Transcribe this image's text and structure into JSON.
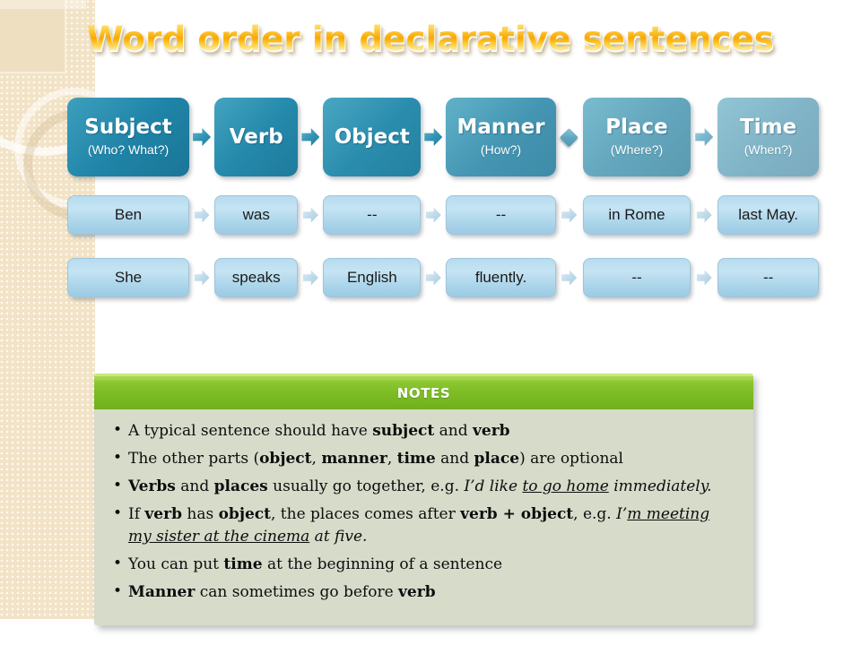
{
  "slide": {
    "title": "Word order in declarative sentences",
    "title_color": "#f9a800",
    "background_color": "#ffffff"
  },
  "decoration": {
    "strip_color": "#f2e3c6",
    "ring_color": "#ffffff"
  },
  "flow": {
    "headers": [
      {
        "title": "Subject",
        "subtitle": "(Who? What?)",
        "color": "#1f84a8"
      },
      {
        "title": "Verb",
        "subtitle": "",
        "color": "#2489ab"
      },
      {
        "title": "Object",
        "subtitle": "",
        "color": "#2b8dae"
      },
      {
        "title": "Manner",
        "subtitle": "(How?)",
        "color": "#4596b3"
      },
      {
        "title": "Place",
        "subtitle": "(Where?)",
        "color": "#63a6bd"
      },
      {
        "title": "Time",
        "subtitle": "(When?)",
        "color": "#81b4c7"
      }
    ],
    "connector_icons": [
      "arrow-right-icon",
      "arrow-right-icon",
      "arrow-right-icon",
      "diamond-icon",
      "arrow-right-icon"
    ],
    "examples": [
      {
        "label": "example-row-ben",
        "cells": [
          "Ben",
          "was",
          "--",
          "--",
          "in Rome",
          "last May."
        ]
      },
      {
        "label": "example-row-she",
        "cells": [
          "She",
          "speaks",
          "English",
          "fluently.",
          "--",
          "--"
        ]
      }
    ],
    "example_box_color": "#bcdced"
  },
  "notes": {
    "header": "NOTES",
    "header_color": "#7cbb24",
    "body_color": "#d7dbca",
    "items": [
      "A typical sentence should have <b>subject</b> and <b>verb</b>",
      "The other parts (<b>object</b>, <b>manner</b>, <b>time</b> and <b>place</b>) are optional",
      "<b>Verbs</b> and <b>places</b> usually go together, e.g. <i>I’d like <u>to go home</u> immediately.</i>",
      "If <b>verb</b> has <b>object</b>, the places comes after <b>verb + object</b>, e.g. <i>I’<u>m meeting my sister  at the cinema</u> at five.</i>",
      "You can put <b>time</b> at the beginning of a sentence",
      "<b>Manner</b> can sometimes go before <b>verb</b>"
    ]
  }
}
